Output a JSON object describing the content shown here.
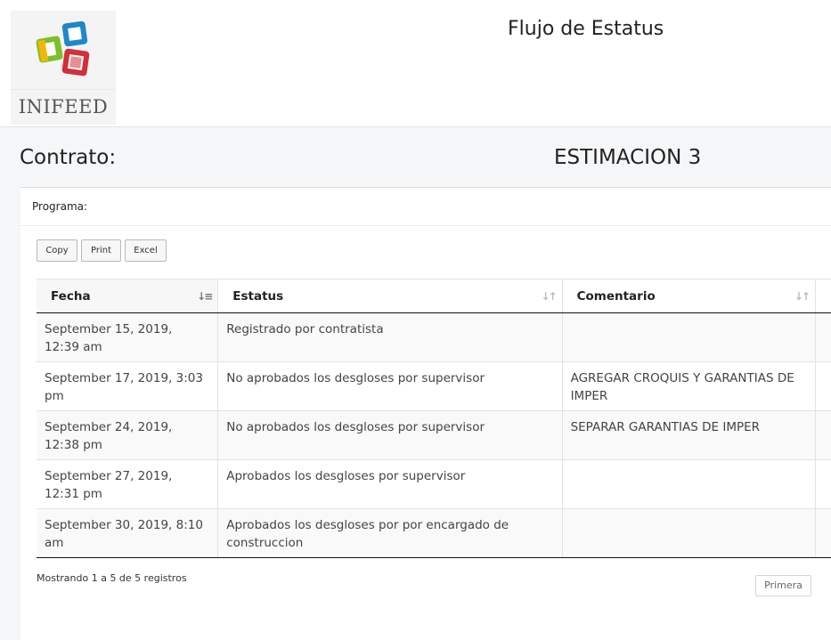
{
  "brand": {
    "logo_text": "INIFEED",
    "colors": [
      "#1e88c8",
      "#7cbf2a",
      "#f2b705",
      "#d32f3a"
    ]
  },
  "page": {
    "title": "Flujo de Estatus"
  },
  "contract": {
    "label": "Contrato:",
    "value": "ESTIMACION 3"
  },
  "panel": {
    "programa_label": "Programa:"
  },
  "toolbar": {
    "copy_label": "Copy",
    "print_label": "Print",
    "excel_label": "Excel"
  },
  "table": {
    "headers": [
      "Fecha",
      "Estatus",
      "Comentario"
    ],
    "sort": {
      "column": "Fecha",
      "icon": "sort-amount-down-icon"
    },
    "rows": [
      {
        "fecha": "September 15, 2019, 12:39 am",
        "estatus": "Registrado por contratista",
        "comentario": ""
      },
      {
        "fecha": "September 17, 2019, 3:03 pm",
        "estatus": "No aprobados los desgloses por supervisor",
        "comentario": "AGREGAR CROQUIS Y GARANTIAS DE IMPER"
      },
      {
        "fecha": "September 24, 2019, 12:38 pm",
        "estatus": "No aprobados los desgloses por supervisor",
        "comentario": "SEPARAR GARANTIAS DE IMPER"
      },
      {
        "fecha": "September 27, 2019, 12:31 pm",
        "estatus": "Aprobados los desgloses por supervisor",
        "comentario": ""
      },
      {
        "fecha": "September 30, 2019, 8:10 am",
        "estatus": "Aprobados los desgloses por por encargado de construccion",
        "comentario": ""
      }
    ]
  },
  "footer": {
    "info": "Mostrando 1 a 5 de 5 registros",
    "first_label": "Primera"
  }
}
